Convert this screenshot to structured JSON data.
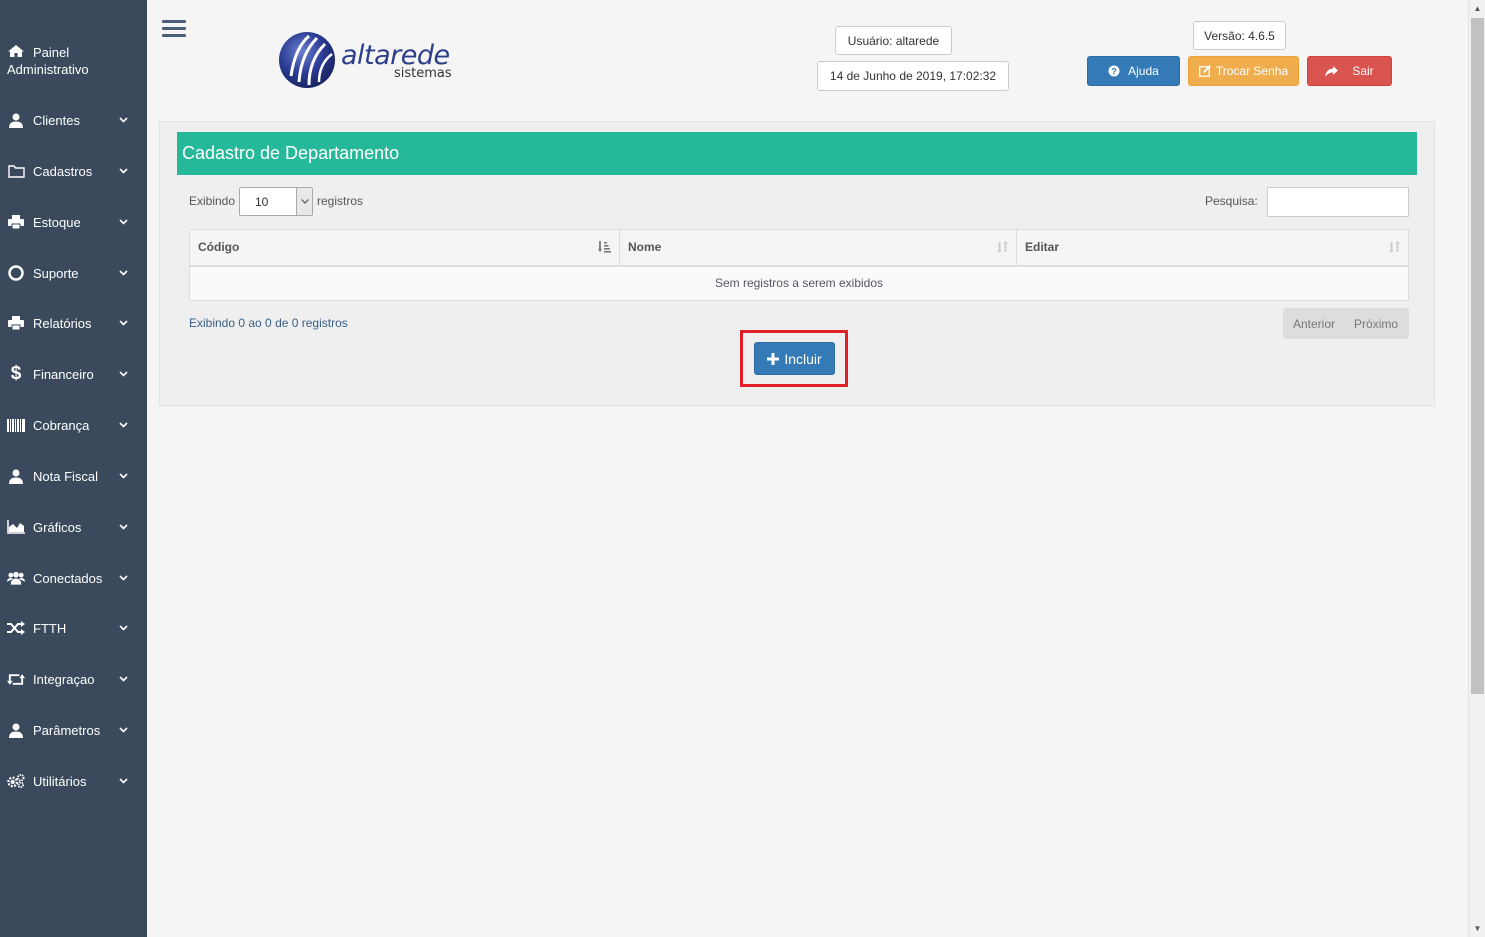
{
  "sidebar": {
    "home": {
      "line1": "Painel",
      "line2": "Administrativo",
      "icon": "home-icon"
    },
    "items": [
      {
        "label": "Clientes",
        "icon": "user-icon"
      },
      {
        "label": "Cadastros",
        "icon": "folder-icon"
      },
      {
        "label": "Estoque",
        "icon": "printer-icon"
      },
      {
        "label": "Suporte",
        "icon": "lifebuoy-icon"
      },
      {
        "label": "Relatórios",
        "icon": "printer-icon"
      },
      {
        "label": "Financeiro",
        "icon": "dollar-icon"
      },
      {
        "label": "Cobrança",
        "icon": "barcode-icon"
      },
      {
        "label": "Nota Fiscal",
        "icon": "user-icon"
      },
      {
        "label": "Gráficos",
        "icon": "area-chart-icon"
      },
      {
        "label": "Conectados",
        "icon": "users-icon"
      },
      {
        "label": "FTTH",
        "icon": "random-icon"
      },
      {
        "label": "Integraçao",
        "icon": "retweet-icon"
      },
      {
        "label": "Parâmetros",
        "icon": "user-icon"
      },
      {
        "label": "Utilitários",
        "icon": "gears-icon"
      }
    ]
  },
  "header": {
    "logo_text": "altarede",
    "logo_sub": "sistemas",
    "user": "Usuário: altarede",
    "datetime": "14 de Junho de 2019, 17:02:32",
    "version": "Versão: 4.6.5",
    "help_label": "Ajuda",
    "password_label": "Trocar Senha",
    "logout_label": "Sair"
  },
  "panel": {
    "title": "Cadastro de Departamento",
    "showing_prefix": "Exibindo",
    "page_size": "10",
    "showing_suffix": "registros",
    "search_label": "Pesquisa:",
    "search_value": "",
    "columns": [
      "Código",
      "Nome",
      "Editar"
    ],
    "empty_message": "Sem registros a serem exibidos",
    "info": "Exibindo 0 ao 0 de 0 registros",
    "prev_label": "Anterior",
    "next_label": "Próximo",
    "add_label": "Incluir"
  },
  "colors": {
    "sidebar": "#3a4a5c",
    "panel_header": "#26b999",
    "primary": "#337ab7",
    "warning": "#f0ad4e",
    "danger": "#d9534f",
    "highlight": "#e01f26"
  }
}
